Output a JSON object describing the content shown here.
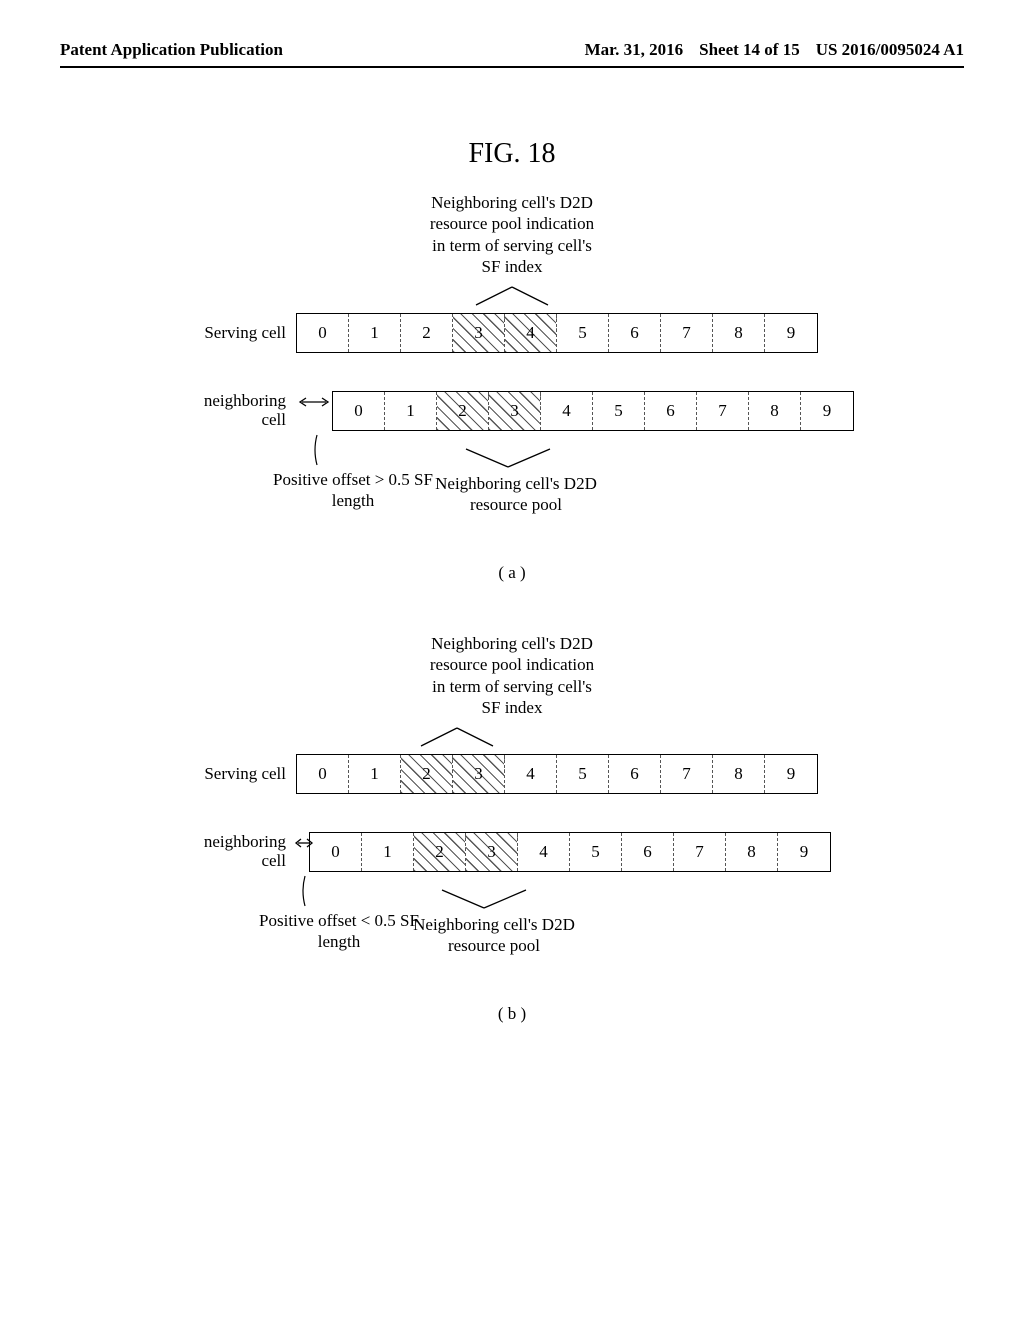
{
  "header": {
    "left": "Patent Application Publication",
    "date": "Mar. 31, 2016",
    "sheet": "Sheet 14 of 15",
    "pubno": "US 2016/0095024 A1"
  },
  "figure_title": "FIG. 18",
  "top_annot": {
    "l1": "Neighboring cell's D2D",
    "l2": "resource pool indication",
    "l3": "in term of serving cell's",
    "l4": "SF index"
  },
  "labels": {
    "serving": "Serving cell",
    "neighbor_l1": "neighboring",
    "neighbor_l2": "cell"
  },
  "sf_values": [
    "0",
    "1",
    "2",
    "3",
    "4",
    "5",
    "6",
    "7",
    "8",
    "9"
  ],
  "under": {
    "offset_a": "Positive offset > 0.5 SF",
    "offset_b": "Positive offset < 0.5 SF",
    "offset_len": "length",
    "pool_l1": "Neighboring cell's D2D",
    "pool_l2": "resource pool"
  },
  "subcaps": {
    "a": "( a )",
    "b": "( b )"
  },
  "chart_data": [
    {
      "type": "table",
      "title": "FIG. 18 (a) — positive offset > 0.5 SF",
      "serving_cell": {
        "sf_indices": [
          0,
          1,
          2,
          3,
          4,
          5,
          6,
          7,
          8,
          9
        ],
        "d2d_pool_indication_sf": [
          3,
          4
        ]
      },
      "neighboring_cell": {
        "sf_indices": [
          0,
          1,
          2,
          3,
          4,
          5,
          6,
          7,
          8,
          9
        ],
        "offset_sf": 0.7,
        "d2d_resource_pool_sf": [
          2,
          3
        ]
      }
    },
    {
      "type": "table",
      "title": "FIG. 18 (b) — positive offset < 0.5 SF",
      "serving_cell": {
        "sf_indices": [
          0,
          1,
          2,
          3,
          4,
          5,
          6,
          7,
          8,
          9
        ],
        "d2d_pool_indication_sf": [
          2,
          3
        ]
      },
      "neighboring_cell": {
        "sf_indices": [
          0,
          1,
          2,
          3,
          4,
          5,
          6,
          7,
          8,
          9
        ],
        "offset_sf": 0.25,
        "d2d_resource_pool_sf": [
          2,
          3
        ]
      }
    }
  ]
}
